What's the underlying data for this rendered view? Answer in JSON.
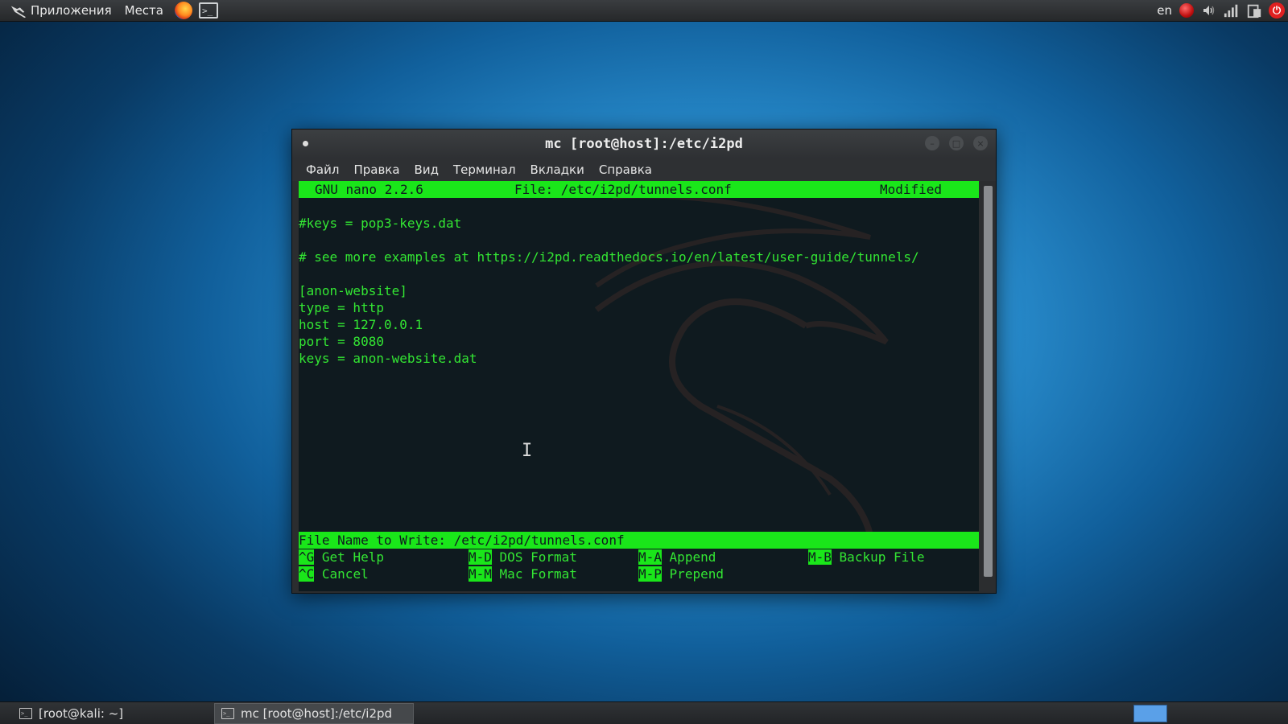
{
  "top_panel": {
    "applications_label": "Приложения",
    "places_label": "Места",
    "keyboard_layout": "en"
  },
  "window": {
    "title": "mc [root@host]:/etc/i2pd",
    "menu": [
      "Файл",
      "Правка",
      "Вид",
      "Терминал",
      "Вкладки",
      "Справка"
    ]
  },
  "nano": {
    "version": "GNU nano 2.2.6",
    "file": "File: /etc/i2pd/tunnels.conf",
    "state": "Modified",
    "lines": [
      "#keys = pop3-keys.dat",
      "",
      "# see more examples at https://i2pd.readthedocs.io/en/latest/user-guide/tunnels/",
      "",
      "[anon-website]",
      "type = http",
      "host = 127.0.0.1",
      "port = 8080",
      "keys = anon-website.dat"
    ],
    "prompt": "File Name to Write: /etc/i2pd/tunnels.conf",
    "shortcuts": [
      {
        "key": "^G",
        "label": "Get Help"
      },
      {
        "key": "M-D",
        "label": "DOS Format"
      },
      {
        "key": "M-A",
        "label": "Append"
      },
      {
        "key": "M-B",
        "label": "Backup File"
      },
      {
        "key": "^C",
        "label": "Cancel"
      },
      {
        "key": "M-M",
        "label": "Mac Format"
      },
      {
        "key": "M-P",
        "label": "Prepend"
      }
    ]
  },
  "taskbar": {
    "tasks": [
      {
        "label": "[root@kali: ~]",
        "active": false
      },
      {
        "label": "mc [root@host]:/etc/i2pd",
        "active": true
      }
    ]
  },
  "colors": {
    "terminal_green": "#33e633",
    "highlight_green": "#1ae61a",
    "terminal_bg": "#0f1a1f"
  }
}
